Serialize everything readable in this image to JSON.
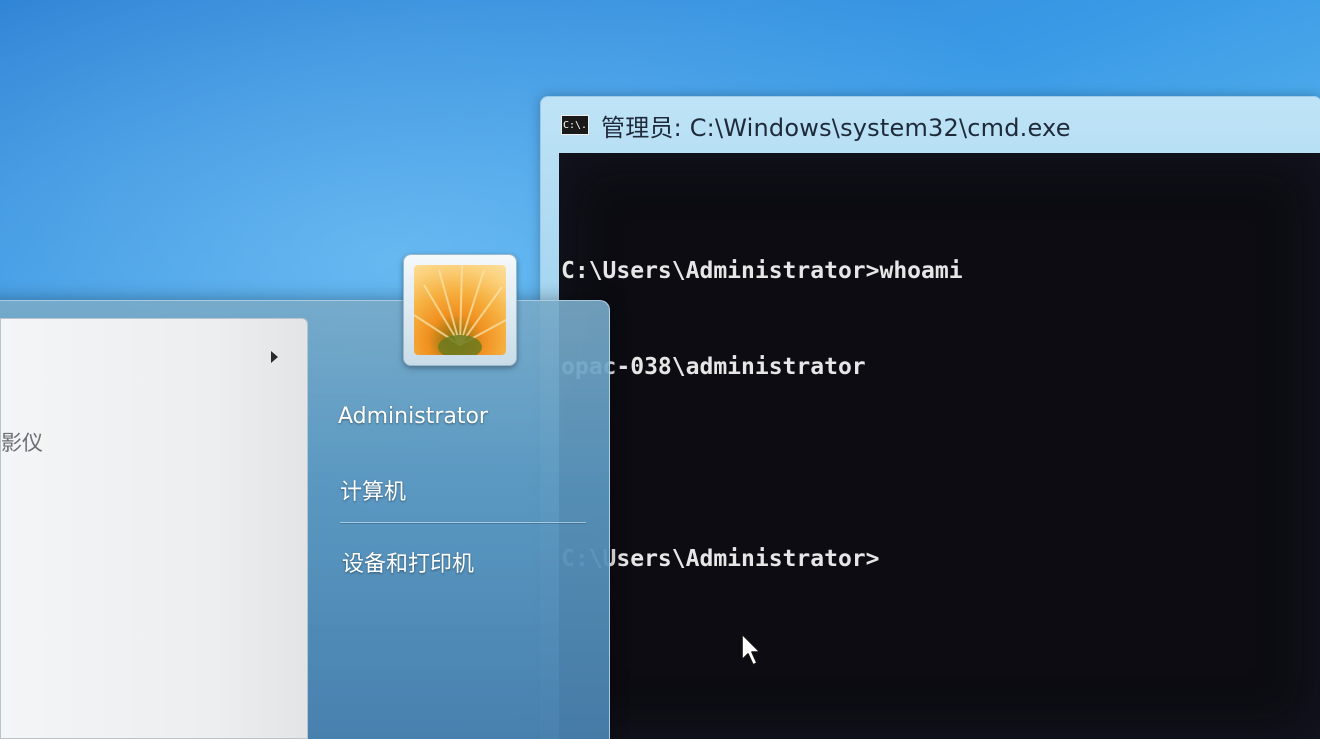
{
  "cmd_window": {
    "title": "管理员: C:\\Windows\\system32\\cmd.exe",
    "icon_label": "C:\\.",
    "lines": [
      "C:\\Users\\Administrator>whoami",
      "opac-038\\administrator",
      "",
      "C:\\Users\\Administrator>"
    ]
  },
  "start_menu": {
    "user_name": "Administrator",
    "items": {
      "computer": "计算机",
      "devices_printers": "设备和打印机"
    },
    "program_partial_label": "影仪"
  },
  "icons": {
    "cmd": "cmd-icon",
    "avatar": "user-avatar-flower",
    "submenu": "chevron-right-icon",
    "cursor": "mouse-cursor-icon"
  }
}
